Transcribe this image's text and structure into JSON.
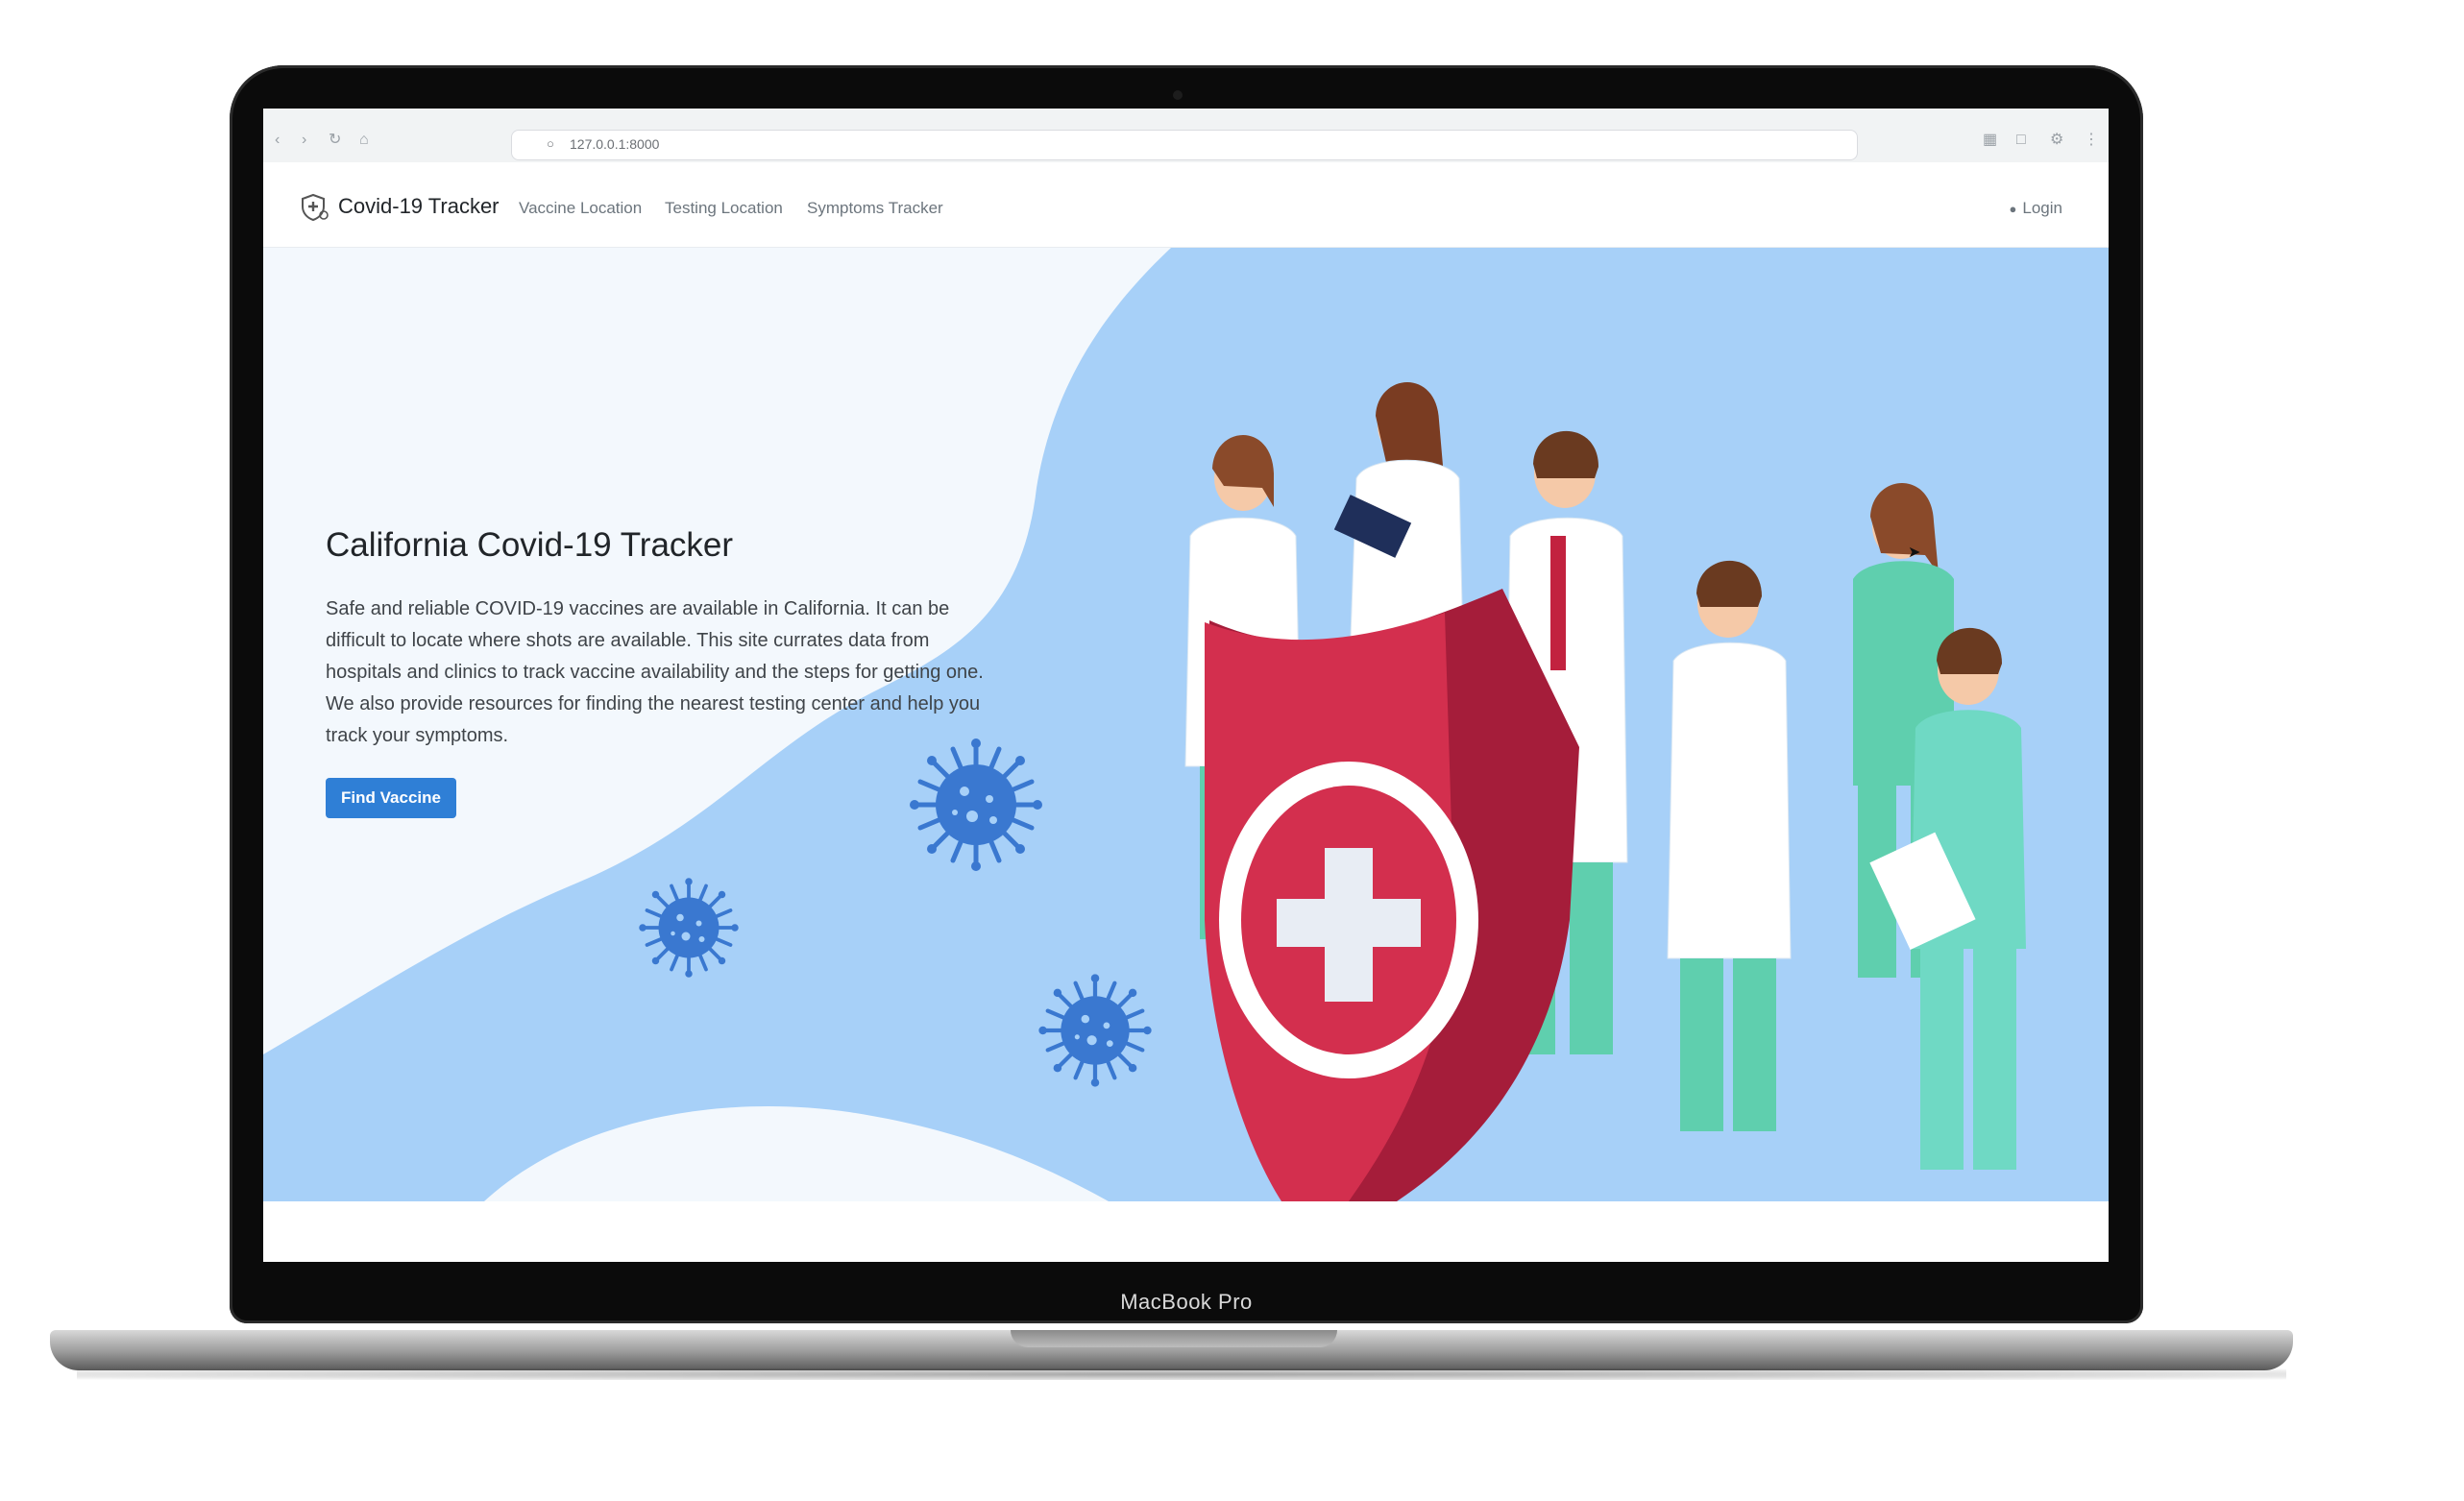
{
  "device": {
    "label": "MacBook Pro"
  },
  "browser": {
    "url": "127.0.0.1:8000",
    "icons": [
      "back-icon",
      "forward-icon",
      "reload-icon",
      "lock-icon"
    ]
  },
  "site": {
    "brand": "Covid-19 Tracker",
    "nav": [
      {
        "label": "Vaccine Location"
      },
      {
        "label": "Testing Location"
      },
      {
        "label": "Symptoms Tracker"
      }
    ],
    "login_label": "Login"
  },
  "hero": {
    "title": "California Covid-19 Tracker",
    "description": "Safe and reliable COVID-19 vaccines are available in California. It can be difficult to locate where shots are available. This site currates data from hospitals and clinics to track vaccine availability and the steps for getting one. We also provide resources for finding the nearest testing center and help you track your symptoms.",
    "cta_label": "Find Vaccine"
  },
  "colors": {
    "accent": "#2f7fd6",
    "hero_background": "#a7d0f8",
    "hero_wave": "#f3f8fd",
    "virus": "#3a78d0",
    "shield": "#d32f4e",
    "scrubs": "#5fcfae"
  }
}
